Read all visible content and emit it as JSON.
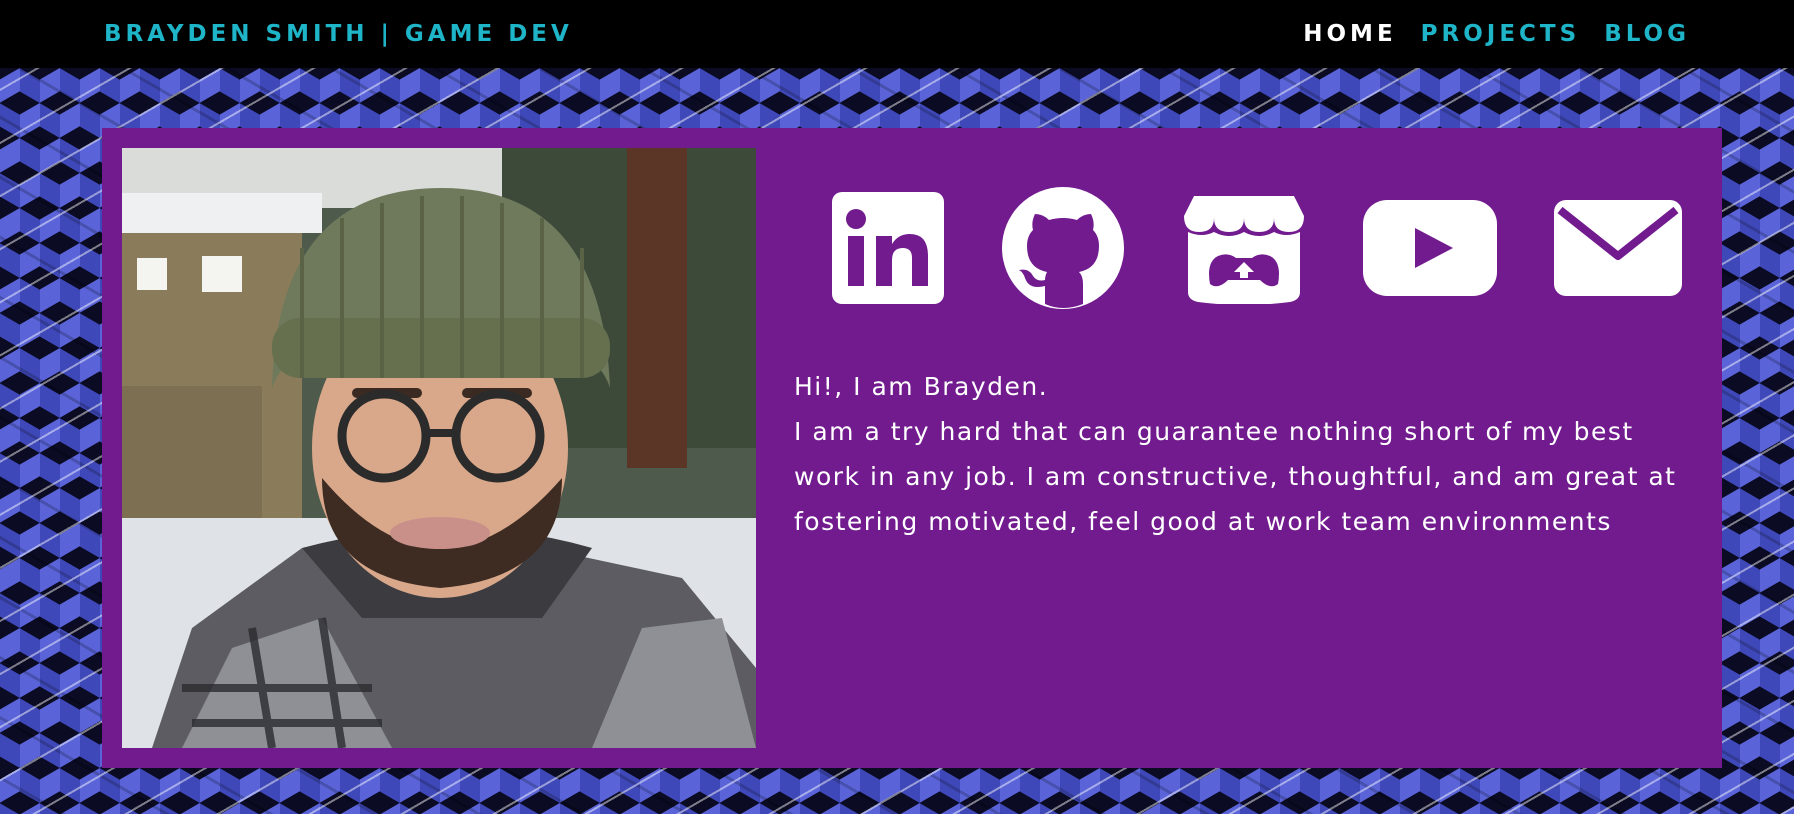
{
  "header": {
    "brand": "Brayden Smith | Game Dev",
    "nav": [
      {
        "label": "Home",
        "active": true
      },
      {
        "label": "Projects",
        "active": false
      },
      {
        "label": "Blog",
        "active": false
      }
    ]
  },
  "colors": {
    "accent": "#1fb5c9",
    "card": "#721b8f",
    "pattern": "#5a64d8"
  },
  "profile": {
    "photo_alt": "Portrait of Brayden in a green beanie and plaid jacket in the snow"
  },
  "socials": [
    {
      "name": "linkedin-icon"
    },
    {
      "name": "github-icon"
    },
    {
      "name": "itchio-icon"
    },
    {
      "name": "youtube-icon"
    },
    {
      "name": "email-icon"
    }
  ],
  "bio": {
    "greeting": "Hi!, I am Brayden.",
    "body": "I am a try hard that can guarantee nothing short of my best work in any job. I am constructive, thoughtful, and am great at fostering motivated, feel good at work team environments"
  }
}
